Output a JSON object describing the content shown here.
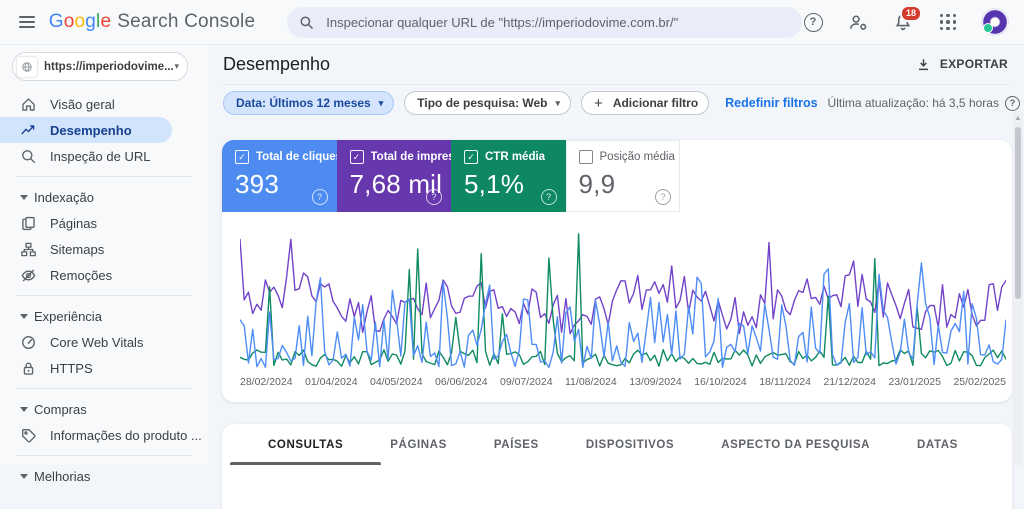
{
  "colors": {
    "brand_letter_colors": [
      "#4285F4",
      "#EA4335",
      "#FBBC05",
      "#4285F4",
      "#34A853",
      "#EA4335"
    ],
    "selected_nav_bg": "#d2e3fc",
    "selected_nav_fg": "#17418f",
    "link_blue": "#1a73e8",
    "badge_red": "#d23b2d",
    "clicks_blue": "#4d8bf0",
    "impressions_purple": "#6637ad",
    "ctr_teal": "#0e8763"
  },
  "glyphs": {
    "caret_down": "▾",
    "question": "?",
    "plus": "+",
    "check": "✓",
    "scroll_up": "▲"
  },
  "topbar": {
    "logo_brand": "Google",
    "logo_product": "Search Console",
    "search_placeholder": "Inspecionar qualquer URL de \"https://imperiodovime.com.br/\"",
    "notification_count": "18"
  },
  "sidebar": {
    "property_label": "https://imperiodovime....",
    "primary_items": [
      {
        "label": "Visão geral",
        "icon": "home-icon",
        "selected": false
      },
      {
        "label": "Desempenho",
        "icon": "trending-up-icon",
        "selected": true
      },
      {
        "label": "Inspeção de URL",
        "icon": "url-inspection-icon",
        "selected": false
      }
    ],
    "sections": [
      {
        "label": "Indexação",
        "items": [
          {
            "label": "Páginas",
            "icon": "pages-icon"
          },
          {
            "label": "Sitemaps",
            "icon": "sitemaps-icon"
          },
          {
            "label": "Remoções",
            "icon": "removals-icon"
          }
        ]
      },
      {
        "label": "Experiência",
        "items": [
          {
            "label": "Core Web Vitals",
            "icon": "core-web-vitals-icon"
          },
          {
            "label": "HTTPS",
            "icon": "https-lock-icon"
          }
        ]
      },
      {
        "label": "Compras",
        "items": [
          {
            "label": "Informações do produto ...",
            "icon": "product-tag-icon"
          }
        ]
      },
      {
        "label": "Melhorias",
        "items": []
      }
    ]
  },
  "header": {
    "title": "Desempenho",
    "export_label": "EXPORTAR"
  },
  "filterbar": {
    "chips": [
      {
        "label": "Data: Últimos 12 meses",
        "active": true
      },
      {
        "label": "Tipo de pesquisa: Web",
        "active": false
      }
    ],
    "add_filter_label": "Adicionar filtro",
    "reset_label": "Redefinir filtros",
    "last_update": "Última atualização: há 3,5 horas"
  },
  "metrics": [
    {
      "label": "Total de cliques",
      "value": "393",
      "checked": true,
      "bg": "#4d8bf0",
      "fg": "#ffffff"
    },
    {
      "label": "Total de impressõ...",
      "value": "7,68 mil",
      "checked": true,
      "bg": "#6637ad",
      "fg": "#ffffff"
    },
    {
      "label": "CTR média",
      "value": "5,1%",
      "checked": true,
      "bg": "#0e8763",
      "fg": "#ffffff"
    },
    {
      "label": "Posição média",
      "value": "9,9",
      "checked": false,
      "bg": "#ffffff",
      "fg": "#5f6368"
    }
  ],
  "chart_data": {
    "type": "line",
    "title": "",
    "x_tick_labels": [
      "28/02/2024",
      "01/04/2024",
      "04/05/2024",
      "06/06/2024",
      "09/07/2024",
      "11/08/2024",
      "13/09/2024",
      "16/10/2024",
      "18/11/2024",
      "21/12/2024",
      "23/01/2025",
      "25/02/2025"
    ],
    "series": [
      {
        "name": "Total de cliques",
        "color": "#4e8df6",
        "period_total": "393"
      },
      {
        "name": "Total de impressões",
        "color": "#7243c9",
        "period_total": "7,68 mil"
      },
      {
        "name": "CTR média",
        "color": "#0f8a62",
        "period_average": "5,1%"
      }
    ],
    "grid": false,
    "y_axis_labels_visible": false,
    "values_note": "daily jagged series; individual daily values not legible in screenshot, rendered procedurally",
    "generator": {
      "seed": 11,
      "points": 182
    }
  },
  "tabs": {
    "items": [
      "CONSULTAS",
      "PÁGINAS",
      "PAÍSES",
      "DISPOSITIVOS",
      "ASPECTO DA PESQUISA",
      "DATAS"
    ],
    "active_index": 0
  }
}
